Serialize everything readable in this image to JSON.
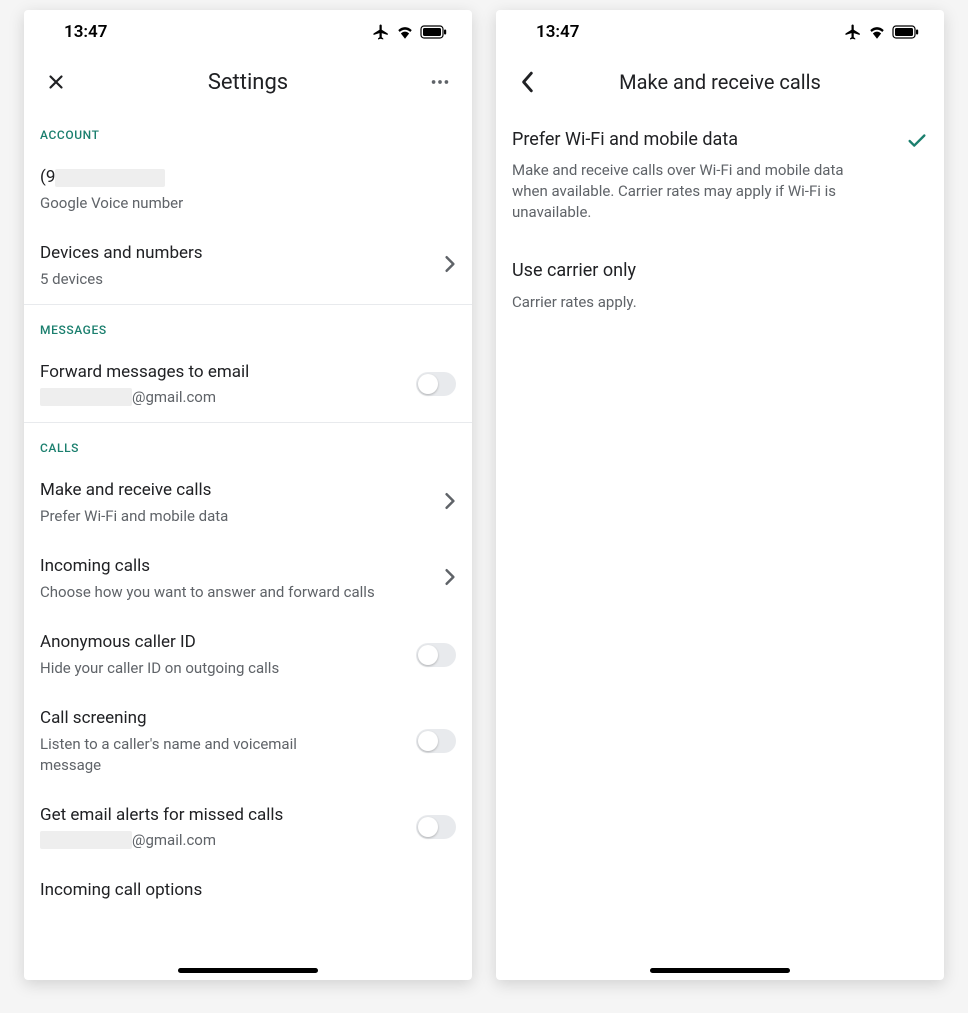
{
  "status": {
    "time": "13:47"
  },
  "left": {
    "title": "Settings",
    "sections": {
      "account": {
        "header": "ACCOUNT",
        "number_prefix": "(9",
        "number_caption": "Google Voice number",
        "devices_title": "Devices and numbers",
        "devices_sub": "5 devices"
      },
      "messages": {
        "header": "MESSAGES",
        "forward_title": "Forward messages to email",
        "forward_email_suffix": "@gmail.com"
      },
      "calls": {
        "header": "CALLS",
        "make_title": "Make and receive calls",
        "make_sub": "Prefer Wi-Fi and mobile data",
        "incoming_title": "Incoming calls",
        "incoming_sub": "Choose how you want to answer and forward calls",
        "anon_title": "Anonymous caller ID",
        "anon_sub": "Hide your caller ID on outgoing calls",
        "screen_title": "Call screening",
        "screen_sub": "Listen to a caller's name and voicemail message",
        "missed_title": "Get email alerts for missed calls",
        "missed_email_suffix": "@gmail.com",
        "options_title": "Incoming call options"
      }
    }
  },
  "right": {
    "title": "Make and receive calls",
    "opt1_title": "Prefer Wi-Fi and mobile data",
    "opt1_sub": "Make and receive calls over Wi-Fi and mobile data when available. Carrier rates may apply if Wi-Fi is unavailable.",
    "opt2_title": "Use carrier only",
    "opt2_sub": "Carrier rates apply."
  }
}
